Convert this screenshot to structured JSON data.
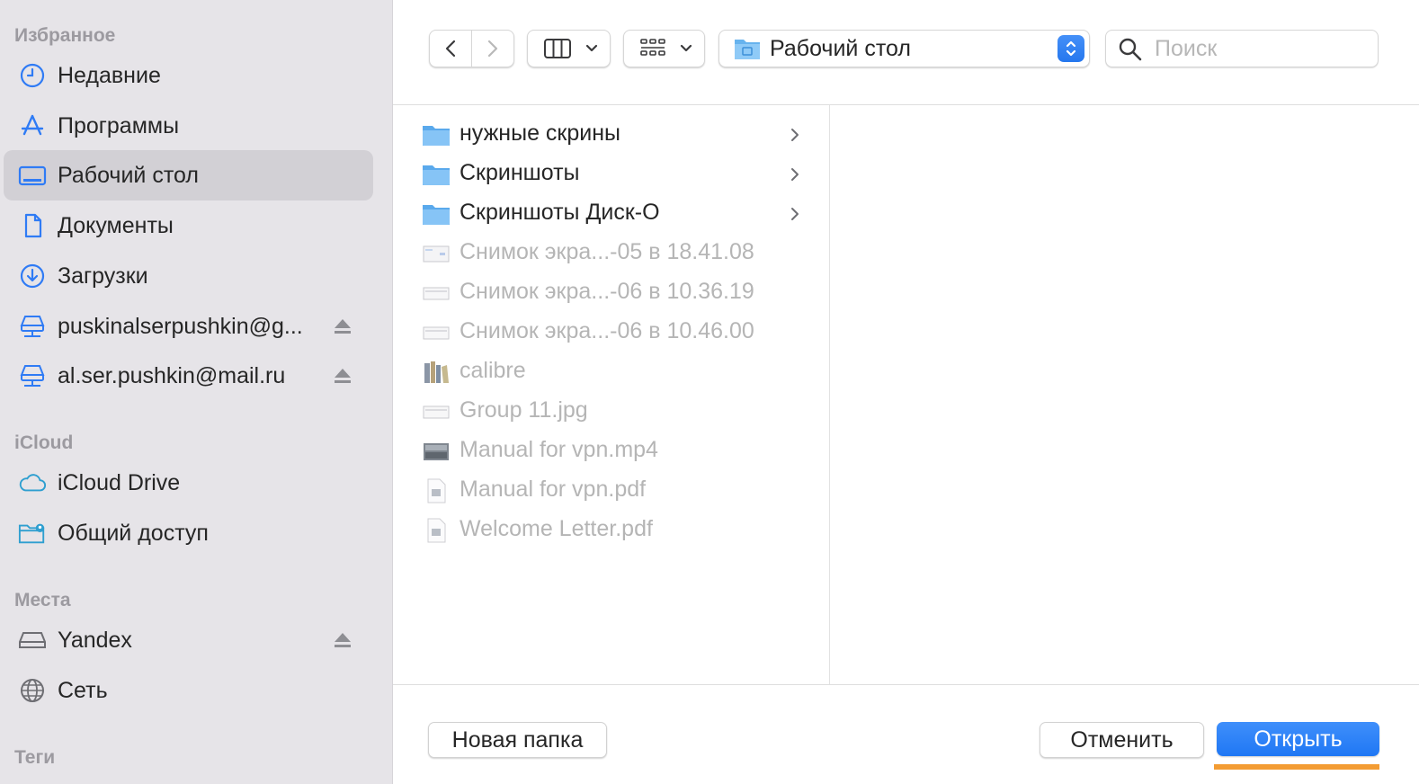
{
  "sidebar": {
    "favorites_title": "Избранное",
    "favorites": [
      {
        "label": "Недавние",
        "icon": "clock-icon"
      },
      {
        "label": "Программы",
        "icon": "apps-icon"
      },
      {
        "label": "Рабочий стол",
        "icon": "desktop-icon",
        "selected": true
      },
      {
        "label": "Документы",
        "icon": "document-icon"
      },
      {
        "label": "Загрузки",
        "icon": "download-icon"
      },
      {
        "label": "puskinalserpushkin@g...",
        "icon": "network-drive-icon",
        "eject": true
      },
      {
        "label": "al.ser.pushkin@mail.ru",
        "icon": "network-drive-icon",
        "eject": true
      }
    ],
    "icloud_title": "iCloud",
    "icloud": [
      {
        "label": "iCloud Drive",
        "icon": "cloud-icon"
      },
      {
        "label": "Общий доступ",
        "icon": "shared-folder-icon"
      }
    ],
    "places_title": "Места",
    "places": [
      {
        "label": "Yandex",
        "icon": "disk-icon",
        "eject": true
      },
      {
        "label": "Сеть",
        "icon": "globe-icon"
      }
    ],
    "tags_title": "Теги"
  },
  "toolbar": {
    "location": "Рабочий стол",
    "search_placeholder": "Поиск"
  },
  "files": [
    {
      "name": "нужные скрины",
      "type": "folder",
      "enabled": true
    },
    {
      "name": "Скриншоты",
      "type": "folder",
      "enabled": true
    },
    {
      "name": "Скриншоты Диск-О",
      "type": "folder",
      "enabled": true
    },
    {
      "name": "Снимок экра...-05 в 18.41.08",
      "type": "image",
      "enabled": false
    },
    {
      "name": "Снимок экра...-06 в 10.36.19",
      "type": "image",
      "enabled": false
    },
    {
      "name": "Снимок экра...-06 в 10.46.00",
      "type": "image",
      "enabled": false
    },
    {
      "name": "calibre",
      "type": "app",
      "enabled": false
    },
    {
      "name": "Group 11.jpg",
      "type": "image",
      "enabled": false
    },
    {
      "name": "Manual for vpn.mp4",
      "type": "video",
      "enabled": false
    },
    {
      "name": "Manual for vpn.pdf",
      "type": "pdf",
      "enabled": false
    },
    {
      "name": "Welcome Letter.pdf",
      "type": "pdf",
      "enabled": false
    }
  ],
  "footer": {
    "new_folder": "Новая папка",
    "cancel": "Отменить",
    "open": "Открыть"
  },
  "colors": {
    "accent": "#1f77f4",
    "sidebar_icon": "#2f7bf5",
    "highlight": "#f39c33"
  }
}
